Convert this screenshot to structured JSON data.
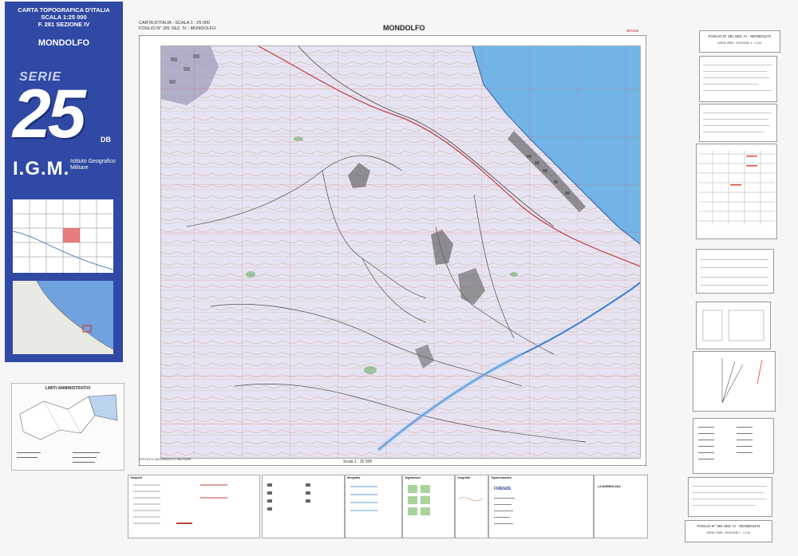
{
  "cover": {
    "line1": "CARTA TOPOGRAFICA D'ITALIA",
    "line2": "SCALA 1:25 000",
    "line3": "F. 281 SEZIONE IV",
    "place": "MONDOLFO",
    "serie": "SERIE",
    "number": "25",
    "suffix": "DB",
    "igm": "I.G.M.",
    "igm_full": "Istituto Geografico Militare"
  },
  "admin_box": {
    "title": "LIMITI AMMINISTRATIVI"
  },
  "header": {
    "left_line1": "CARTA D'ITALIA  -  SCALA 1 : 25 000",
    "left_line2": "FOGLIO N° 281 SEZ. IV - MONDOLFO",
    "title": "MONDOLFO",
    "right_code": "WG334"
  },
  "footer": {
    "publisher": "ISTITUTO GEOGRAFICO MILITARE",
    "scale_label": "Scala 1 : 25 000"
  },
  "panels": {
    "foglio_top_a": "FOGLIO N° 281 SEZ. IV - MONDOLFO",
    "foglio_top_b": "SERIE 25DB - EDIZIONE 1 - I.G.M.",
    "foglio_bot_a": "FOGLIO N° 281 SEZ. IV - MONDOLFO",
    "foglio_bot_b": "SERIE 25DB - EDIZIONE 1 - I.G.M."
  },
  "legend": {
    "col1": "Trasporti",
    "col2": "Idrografia",
    "col3": "Vegetazione",
    "col4": "Orografia",
    "col5": "Toponomastica",
    "firenze": "FIRENZE",
    "marmolada": "LA MARMOLADA"
  },
  "map": {
    "sea_color": "#73b4e6",
    "contour_color": "#c78a5a",
    "grid_color": "#e05050"
  }
}
